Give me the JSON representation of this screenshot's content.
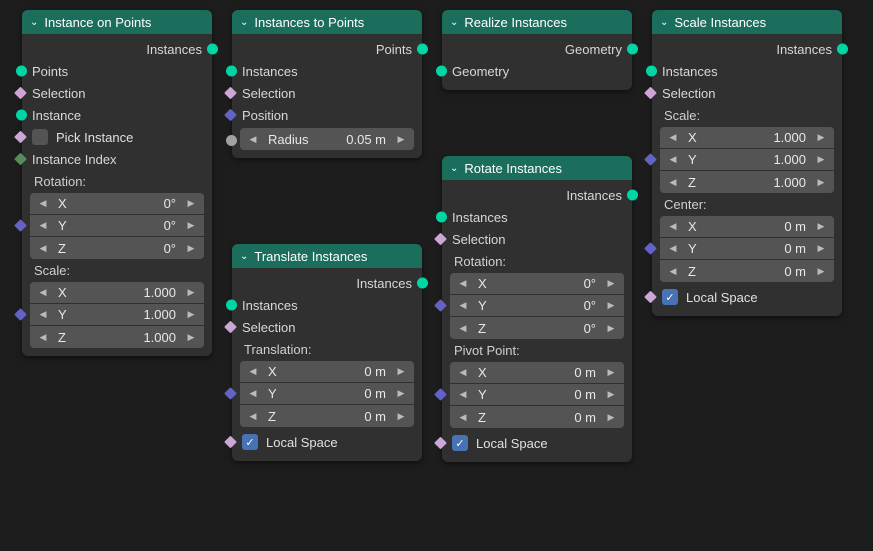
{
  "nodes": {
    "instance_on_points": {
      "title": "Instance on Points",
      "out": "Instances",
      "inputs": [
        "Points",
        "Selection",
        "Instance",
        "Pick Instance",
        "Instance Index"
      ],
      "rotation_label": "Rotation:",
      "rotation": {
        "x": {
          "k": "X",
          "v": "0°"
        },
        "y": {
          "k": "Y",
          "v": "0°"
        },
        "z": {
          "k": "Z",
          "v": "0°"
        }
      },
      "scale_label": "Scale:",
      "scale": {
        "x": {
          "k": "X",
          "v": "1.000"
        },
        "y": {
          "k": "Y",
          "v": "1.000"
        },
        "z": {
          "k": "Z",
          "v": "1.000"
        }
      }
    },
    "instances_to_points": {
      "title": "Instances to Points",
      "out": "Points",
      "inputs": [
        "Instances",
        "Selection",
        "Position"
      ],
      "radius": {
        "k": "Radius",
        "v": "0.05 m"
      }
    },
    "translate_instances": {
      "title": "Translate Instances",
      "out": "Instances",
      "inputs": [
        "Instances",
        "Selection"
      ],
      "translation_label": "Translation:",
      "translation": {
        "x": {
          "k": "X",
          "v": "0 m"
        },
        "y": {
          "k": "Y",
          "v": "0 m"
        },
        "z": {
          "k": "Z",
          "v": "0 m"
        }
      },
      "local_space": "Local Space"
    },
    "realize_instances": {
      "title": "Realize Instances",
      "out": "Geometry",
      "inputs": [
        "Geometry"
      ]
    },
    "rotate_instances": {
      "title": "Rotate Instances",
      "out": "Instances",
      "inputs": [
        "Instances",
        "Selection"
      ],
      "rotation_label": "Rotation:",
      "rotation": {
        "x": {
          "k": "X",
          "v": "0°"
        },
        "y": {
          "k": "Y",
          "v": "0°"
        },
        "z": {
          "k": "Z",
          "v": "0°"
        }
      },
      "pivot_label": "Pivot Point:",
      "pivot": {
        "x": {
          "k": "X",
          "v": "0 m"
        },
        "y": {
          "k": "Y",
          "v": "0 m"
        },
        "z": {
          "k": "Z",
          "v": "0 m"
        }
      },
      "local_space": "Local Space"
    },
    "scale_instances": {
      "title": "Scale Instances",
      "out": "Instances",
      "inputs": [
        "Instances",
        "Selection"
      ],
      "scale_label": "Scale:",
      "scale": {
        "x": {
          "k": "X",
          "v": "1.000"
        },
        "y": {
          "k": "Y",
          "v": "1.000"
        },
        "z": {
          "k": "Z",
          "v": "1.000"
        }
      },
      "center_label": "Center:",
      "center": {
        "x": {
          "k": "X",
          "v": "0 m"
        },
        "y": {
          "k": "Y",
          "v": "0 m"
        },
        "z": {
          "k": "Z",
          "v": "0 m"
        }
      },
      "local_space": "Local Space"
    }
  }
}
